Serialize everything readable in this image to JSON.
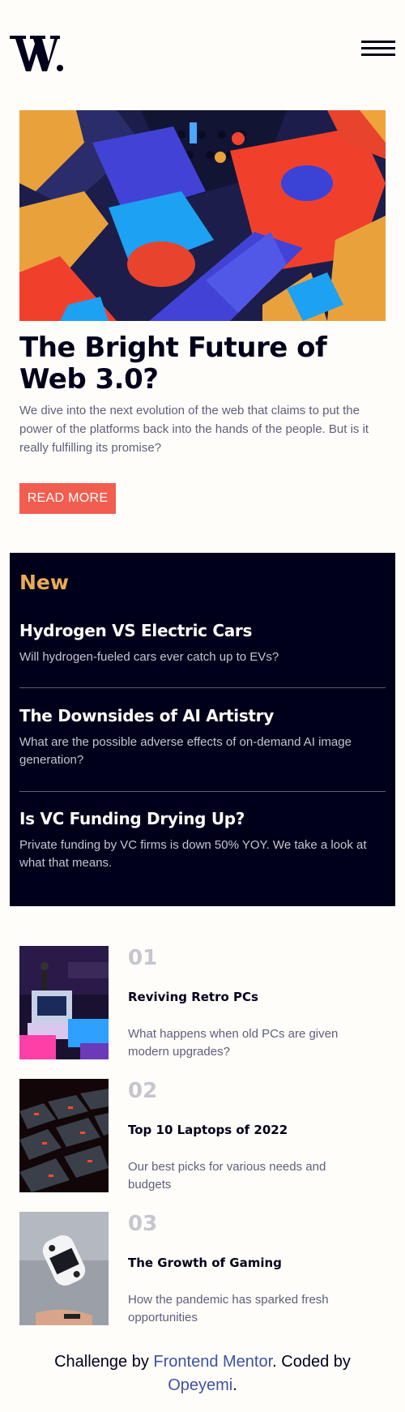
{
  "header": {
    "logo": "W.",
    "menu_icon": "hamburger-menu-icon"
  },
  "hero": {
    "image": "abstract-3d-blocks-image",
    "title": "The Bright Future of Web 3.0?",
    "description": "We dive into the next evolution of the web that claims to put the power of the platforms back into the hands of the people. But is it really fulfilling its promise?",
    "button_label": "READ MORE"
  },
  "new_section": {
    "heading": "New",
    "items": [
      {
        "title": "Hydrogen VS Electric Cars",
        "description": "Will hydrogen-fueled cars ever catch up to EVs?"
      },
      {
        "title": "The Downsides of AI Artistry",
        "description": "What are the possible adverse effects of on-demand AI image generation?"
      },
      {
        "title": "Is VC Funding Drying Up?",
        "description": "Private funding by VC firms is down 50% YOY. We take a look at what that means."
      }
    ]
  },
  "articles": [
    {
      "number": "01",
      "title": "Reviving Retro PCs",
      "description": "What happens when old PCs are given modern upgrades?",
      "image": "retro-pc-image"
    },
    {
      "number": "02",
      "title": "Top 10 Laptops of 2022",
      "description": "Our best picks for various needs and budgets",
      "image": "keyboard-image"
    },
    {
      "number": "03",
      "title": "The Growth of Gaming",
      "description": "How the pandemic has sparked fresh opportunities",
      "image": "gamepad-image"
    }
  ],
  "footer": {
    "prefix": "Challenge by ",
    "link1": "Frontend Mentor",
    "middle": ". Coded by ",
    "link2": "Opeyemi",
    "suffix": "."
  },
  "colors": {
    "accent_red": "#f15e50",
    "accent_orange": "#e9ab53",
    "dark_navy": "#00001a",
    "off_white": "#fffdfa",
    "grayish_blue": "#5d5f79",
    "light_gray": "#c5c6ce"
  }
}
